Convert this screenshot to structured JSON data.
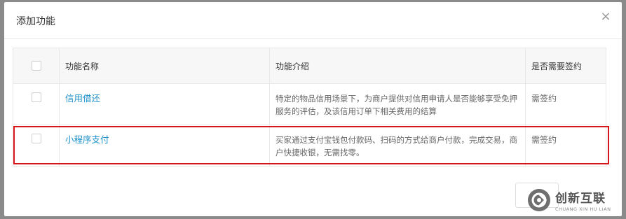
{
  "dialog": {
    "title": "添加功能",
    "close_glyph": "×"
  },
  "table": {
    "headers": [
      "功能名称",
      "功能介绍",
      "是否需要签约"
    ],
    "rows": [
      {
        "name": "信用借还",
        "description": "特定的物品信用场景下，为商户提供对信用申请人是否能够享受免押服务的评估，及该信用订单下相关费用的结算",
        "sign": "需签约",
        "checked": false
      },
      {
        "name": "小程序支付",
        "description": "买家通过支付宝钱包付款码、扫码的方式给商户付款，完成交易，商户快捷收银，无需找零。",
        "sign": "需签约",
        "checked": false
      }
    ]
  },
  "watermark": {
    "cn": "创新互联",
    "en": "CHUANG XIN HU LIAN"
  },
  "colors": {
    "highlight": "#d9141b",
    "link": "#1a8fc9"
  }
}
